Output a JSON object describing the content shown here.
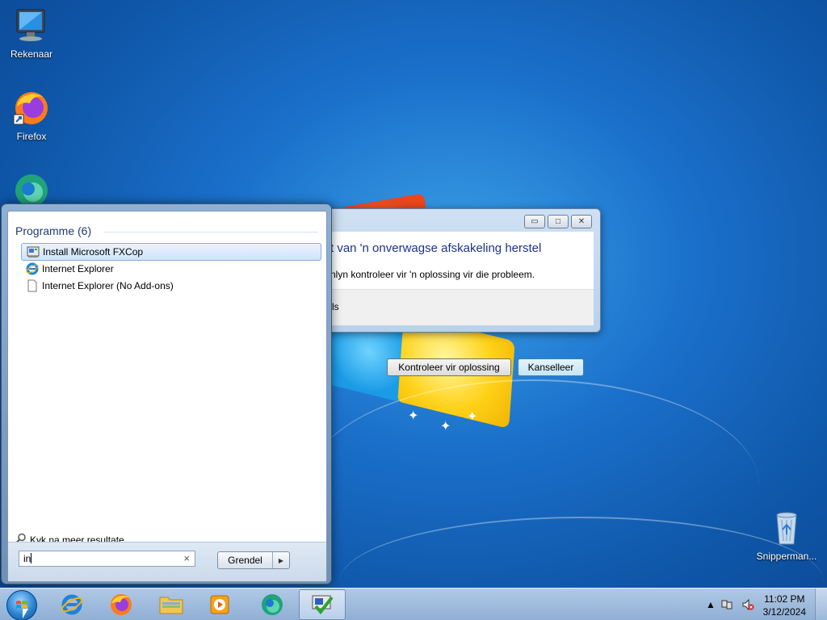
{
  "desktop": {
    "icons": [
      {
        "label": "Rekenaar",
        "icon": "computer-icon"
      },
      {
        "label": "Firefox",
        "icon": "firefox-icon"
      },
      {
        "label": "",
        "icon": "edge-icon"
      },
      {
        "label": "Snipperman...",
        "icon": "recycle-bin-icon"
      }
    ]
  },
  "dialog": {
    "headline": "t van 'n onverwagse afskakeling herstel",
    "body": "nlyn kontroleer vir 'n oplossing vir die probleem.",
    "footer_link": "ls",
    "check_button": "Kontroleer vir oplossing",
    "cancel_button": "Kanselleer",
    "caption_minimize": "▭",
    "caption_maximize": "□",
    "caption_close": "✕"
  },
  "start_menu": {
    "group_title": "Programme (6)",
    "items": [
      {
        "label": "Install Microsoft FXCop",
        "icon": "installer-icon",
        "selected": true
      },
      {
        "label": "Internet Explorer",
        "icon": "internet-explorer-icon",
        "selected": false
      },
      {
        "label": "Internet Explorer (No Add-ons)",
        "icon": "blank-document-icon",
        "selected": false
      }
    ],
    "more_results": "Kyk na meer resultate",
    "search_value": "in",
    "search_clear": "×",
    "shutdown_label": "Grendel",
    "shutdown_arrow": "▶"
  },
  "taskbar": {
    "pinned": [
      {
        "name": "internet-explorer",
        "icon": "internet-explorer-icon"
      },
      {
        "name": "firefox",
        "icon": "firefox-icon"
      },
      {
        "name": "file-explorer",
        "icon": "folder-icon"
      },
      {
        "name": "media-player",
        "icon": "media-player-icon"
      },
      {
        "name": "edge",
        "icon": "edge-icon"
      },
      {
        "name": "fxcop-installer",
        "icon": "installer-icon",
        "active": true
      }
    ],
    "clock_time": "11:02 PM",
    "clock_date": "3/12/2024",
    "tray_chevron": "▲"
  },
  "colors": {
    "dialog_headline": "#1e3287",
    "group_title": "#1e3a6e",
    "desktop_bg": "#1a6fc9"
  }
}
